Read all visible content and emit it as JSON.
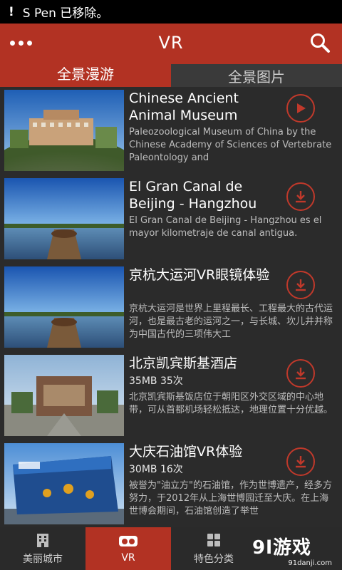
{
  "status_bar": {
    "icon": "exclamation",
    "notification": "S Pen 已移除。"
  },
  "app_bar": {
    "title": "VR",
    "menu_icon": "more-dots-icon",
    "search_icon": "search-icon"
  },
  "tabs": [
    {
      "label": "全景漫游",
      "active": true
    },
    {
      "label": "全景图片",
      "active": false
    }
  ],
  "items": [
    {
      "title": "Chinese Ancient Animal Museum",
      "meta": "",
      "desc": "Paleozoological Museum of China by the Chinese Academy of Sciences of Vertebrate Paleontology and",
      "action": "play-icon"
    },
    {
      "title": "El Gran Canal de Beijing - Hangzhou",
      "meta": "",
      "desc": "El Gran Canal de Beijing - Hangzhou es el mayor kilometraje de canal antigua.",
      "action": "download-icon"
    },
    {
      "title": "京杭大运河VR眼镜体验",
      "meta": "",
      "desc": "京杭大运河是世界上里程最长、工程最大的古代运河，也是最古老的运河之一，与长城、坎儿井并称为中国古代的三项伟大工",
      "action": "download-icon"
    },
    {
      "title": "北京凯宾斯基酒店",
      "meta": "35MB  35次",
      "desc": "北京凯宾斯基饭店位于朝阳区外交区域的中心地带，可从首都机场轻松抵达，地理位置十分优越。",
      "action": "download-icon"
    },
    {
      "title": "大庆石油馆VR体验",
      "meta": "30MB  16次",
      "desc": "被誉为\"油立方\"的石油馆，作为世博遗产，经多方努力，于2012年从上海世博园迁至大庆。在上海世博会期间，石油馆创造了举世",
      "action": "download-icon"
    }
  ],
  "bottom_nav": [
    {
      "label": "美丽城市",
      "icon": "building-icon",
      "active": false
    },
    {
      "label": "VR",
      "icon": "vr-goggles-icon",
      "active": true
    },
    {
      "label": "特色分类",
      "icon": "grid-icon",
      "active": false
    }
  ],
  "watermark": {
    "main": "9l游戏",
    "sub": "91danji.com"
  },
  "colors": {
    "accent": "#b23223",
    "background": "#2b2b2b",
    "icon_ring": "#c0392b"
  }
}
